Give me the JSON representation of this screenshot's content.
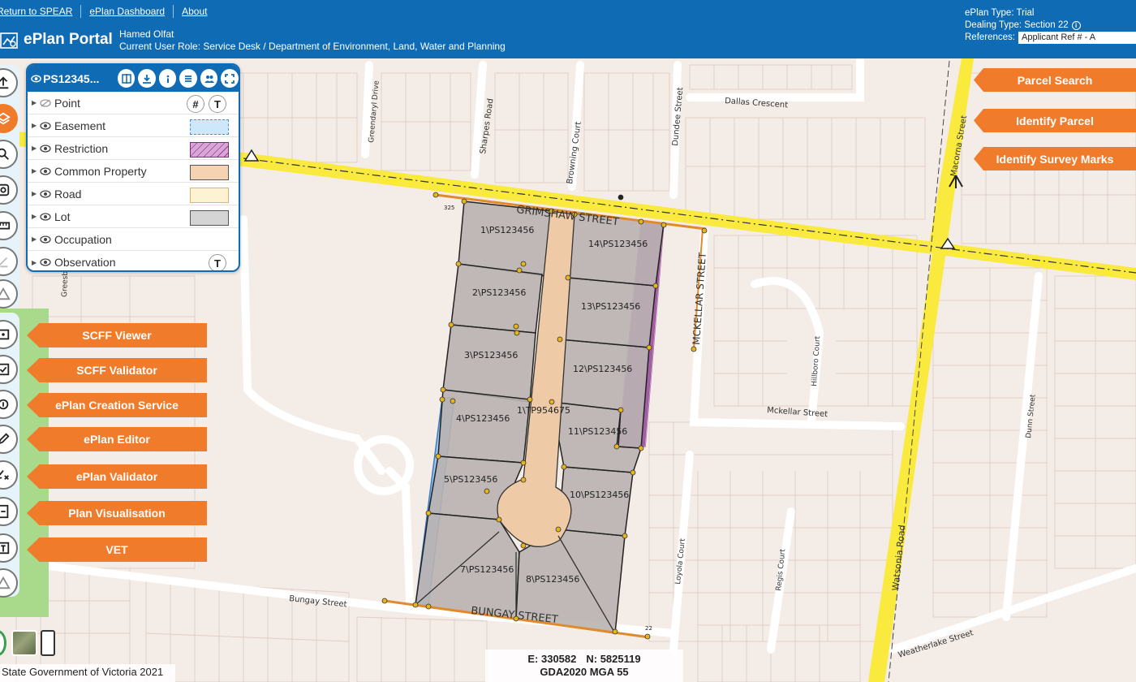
{
  "header": {
    "links": [
      "Return to SPEAR",
      "ePlan Dashboard",
      "About"
    ],
    "brand": "ePlan Portal",
    "user_name": "Hamed Olfat",
    "user_role": "Current User Role:  Service Desk / Department of Environment, Land, Water and Planning",
    "eplan_type": "ePlan Type: Trial",
    "dealing_type": "Dealing Type: Section 22",
    "references_label": "References:",
    "references_value": "Applicant Ref # - A"
  },
  "layer_panel": {
    "title": "PS12345...",
    "layers": [
      {
        "label": "Point",
        "symbol": "hash-t"
      },
      {
        "label": "Easement",
        "symbol": "swatch"
      },
      {
        "label": "Restriction",
        "symbol": "swatch"
      },
      {
        "label": "Common Property",
        "symbol": "swatch"
      },
      {
        "label": "Road",
        "symbol": "swatch"
      },
      {
        "label": "Lot",
        "symbol": "swatch"
      },
      {
        "label": "Occupation",
        "symbol": "none"
      },
      {
        "label": "Observation",
        "symbol": "t"
      }
    ],
    "symbols": {
      "hash": "#",
      "t": "T"
    }
  },
  "right_buttons": [
    "Parcel Search",
    "Identify Parcel",
    "Identify Survey Marks"
  ],
  "service_buttons": [
    "SCFF Viewer",
    "SCFF Validator",
    "ePlan Creation Service",
    "ePlan Editor",
    "ePlan Validator",
    "Plan Visualisation",
    "VET"
  ],
  "map": {
    "streets": {
      "grimshaw": "GRIMSHAW STREET",
      "bungay_caps": "BUNGAY STREET",
      "bungay": "Bungay Street",
      "mckellar_caps": "MCKELLAR STREET",
      "mckellar": "Mckellar Street",
      "watsonia": "Watsonia Road",
      "macorna": "Macorna Street",
      "dallas": "Dallas Crescent",
      "sharpes": "Sharpes Road",
      "browning": "Browning Court",
      "dundee": "Dundee Street",
      "hillboro": "Hillboro Court",
      "loyola": "Loyola Court",
      "regis": "Regis Court",
      "dunn": "Dunn Street",
      "weatherlake": "Weatherlake Street",
      "greendaryl": "Greendaryl Drive",
      "greensborough": "Greesbo"
    },
    "lots": [
      "1\\PS123456",
      "2\\PS123456",
      "3\\PS123456",
      "4\\PS123456",
      "5\\PS123456",
      "7\\PS123456",
      "8\\PS123456",
      "10\\PS123456",
      "11\\PS123456",
      "12\\PS123456",
      "13\\PS123456",
      "14\\PS123456"
    ],
    "common_property": "1\\TP954675",
    "lot_325": "325",
    "lot_22": "22"
  },
  "coords": {
    "easting": "E: 330582",
    "northing": "N: 5825119",
    "datum": "GDA2020 MGA 55"
  },
  "footer": "State Government of Victoria 2021",
  "colors": {
    "header": "#0f6bb4",
    "accent": "#f07b2a",
    "road_yellow": "#f9ea3d",
    "lot": "#b9b3b1",
    "common": "#efcaa6",
    "restriction": "#9b3c9b",
    "easement": "#9cc3e9"
  }
}
